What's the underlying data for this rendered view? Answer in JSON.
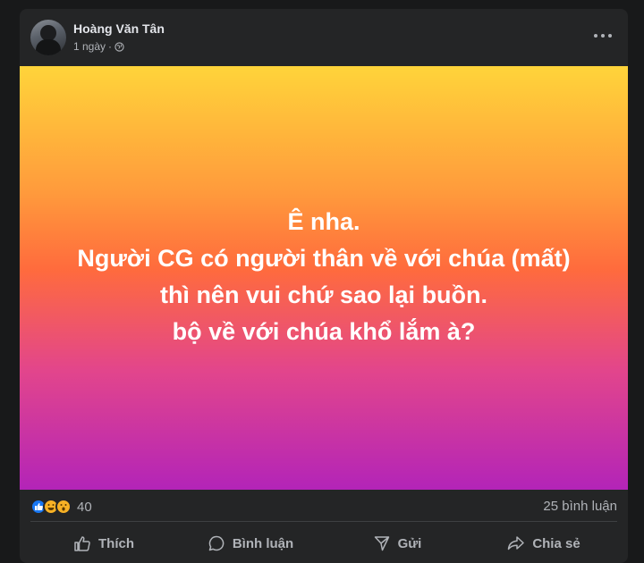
{
  "post": {
    "author": "Hoàng Văn Tân",
    "time": "1 ngày",
    "separator": "·",
    "privacy_icon": "globe-icon",
    "more_icon": "more-options-icon"
  },
  "banner": {
    "lines": [
      "Ê nha.",
      "Người CG có người thân về với chúa (mất)",
      "thì nên vui chứ sao lại buồn.",
      "bộ về với chúa khổ lắm à?"
    ],
    "gradient_top": "#ffd43a",
    "gradient_bottom": "#b324b8"
  },
  "stats": {
    "reaction_icons": [
      "like-icon",
      "haha-icon",
      "wow-icon"
    ],
    "reaction_count": "40",
    "comments": "25 bình luận"
  },
  "actions": {
    "like": "Thích",
    "comment": "Bình luận",
    "send": "Gửi",
    "share": "Chia sẻ"
  },
  "colors": {
    "background": "#18191a",
    "card": "#242526",
    "text_primary": "#e4e6eb",
    "text_secondary": "#b0b3b8",
    "like_blue": "#1877f2"
  }
}
